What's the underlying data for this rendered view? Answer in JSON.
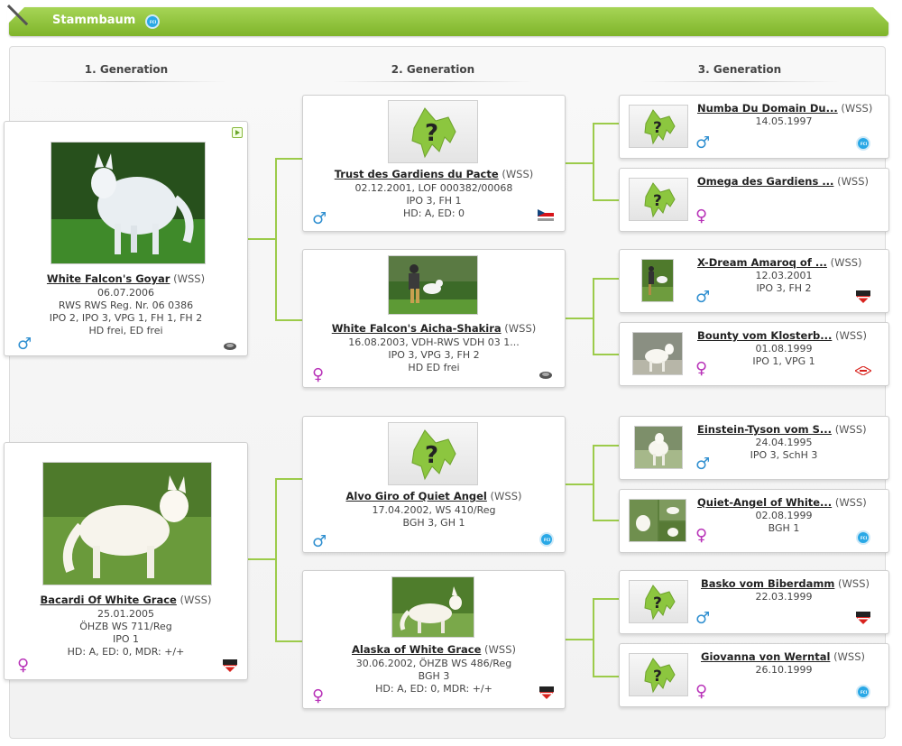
{
  "header": {
    "title": "Stammbaum",
    "icon": "fci-icon"
  },
  "generations": [
    "1. Generation",
    "2. Generation",
    "3. Generation"
  ],
  "gen1": [
    {
      "name": "White Falcon's Goyar",
      "breed": "(WSS)",
      "lines": [
        "06.07.2006",
        "RWS RWS Reg. Nr. 06 0386",
        "IPO 2, IPO 3, VPG 1, FH 1, FH 2",
        "HD frei, ED frei"
      ],
      "sex": "♂",
      "org": "turtle-icon"
    },
    {
      "name": "Bacardi Of White Grace",
      "breed": "(WSS)",
      "lines": [
        "25.01.2005",
        "ÖHZB WS 711/Reg",
        "IPO 1",
        "HD: A, ED: 0, MDR: +/+"
      ],
      "sex": "♀",
      "org": "okv-icon"
    }
  ],
  "gen2": [
    {
      "name": "Trust des Gardiens du Pacte",
      "breed": "(WSS)",
      "lines": [
        "02.12.2001, LOF 000382/00068",
        "IPO 3, FH 1",
        "HD: A, ED: 0"
      ],
      "sex": "♂",
      "org": "cz-flag-icon"
    },
    {
      "name": "White Falcon's Aicha-Shakira",
      "breed": "(WSS)",
      "lines": [
        "16.08.2003, VDH-RWS VDH 03 1...",
        "IPO 3, VPG 3, FH 2",
        "HD ED frei"
      ],
      "sex": "♀",
      "org": "turtle-icon"
    },
    {
      "name": "Alvo Giro of Quiet Angel",
      "breed": "(WSS)",
      "lines": [
        "17.04.2002, WS 410/Reg",
        "BGH 3, GH 1"
      ],
      "sex": "♂",
      "org": "fci-icon"
    },
    {
      "name": "Alaska of White Grace",
      "breed": "(WSS)",
      "lines": [
        "30.06.2002, ÖHZB WS 486/Reg",
        "BGH 3",
        "HD: A, ED: 0, MDR: +/+"
      ],
      "sex": "♀",
      "org": "okv-icon"
    }
  ],
  "gen3": [
    {
      "name": "Numba Du Domain Du...",
      "breed": "(WSS)",
      "lines": [
        "14.05.1997"
      ],
      "sex": "♂",
      "org": "fci-icon"
    },
    {
      "name": "Omega des Gardiens ...",
      "breed": "(WSS)",
      "lines": [],
      "sex": "♀",
      "org": ""
    },
    {
      "name": "X-Dream Amaroq of ...",
      "breed": "(WSS)",
      "lines": [
        "12.03.2001",
        "IPO 3, FH 2"
      ],
      "sex": "♂",
      "org": "okv-icon"
    },
    {
      "name": "Bounty vom Klosterb...",
      "breed": "(WSS)",
      "lines": [
        "01.08.1999",
        "IPO 1, VPG 1"
      ],
      "sex": "♀",
      "org": "vdh-icon"
    },
    {
      "name": "Einstein-Tyson vom S...",
      "breed": "(WSS)",
      "lines": [
        "24.04.1995",
        "IPO 3, SchH 3"
      ],
      "sex": "♂",
      "org": ""
    },
    {
      "name": "Quiet-Angel of White...",
      "breed": "(WSS)",
      "lines": [
        "02.08.1999",
        "BGH 1"
      ],
      "sex": "♀",
      "org": "fci-icon"
    },
    {
      "name": "Basko vom Biberdamm",
      "breed": "(WSS)",
      "lines": [
        "22.03.1999"
      ],
      "sex": "♂",
      "org": "okv-icon"
    },
    {
      "name": "Giovanna von Werntal",
      "breed": "(WSS)",
      "lines": [
        "26.10.1999"
      ],
      "sex": "♀",
      "org": "fci-icon"
    }
  ],
  "colors": {
    "accent": "#8cc63f",
    "male": "#2f8fd0",
    "female": "#b832b8"
  }
}
